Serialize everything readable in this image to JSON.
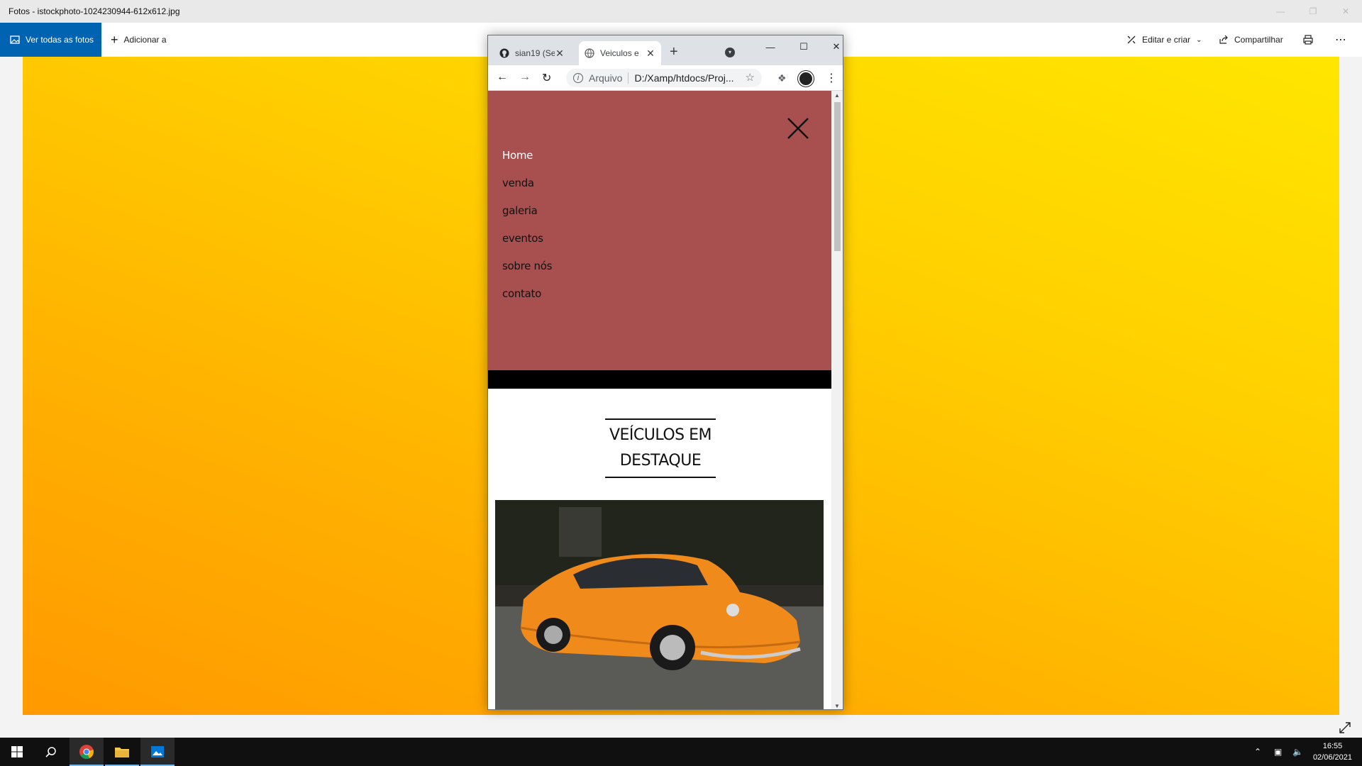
{
  "photos_app": {
    "title": "Fotos - istockphoto-1024230944-612x612.jpg",
    "toolbar": {
      "view_all": "Ver todas as fotos",
      "add_to": "Adicionar a",
      "edit_create": "Editar e criar",
      "share": "Compartilhar"
    }
  },
  "browser": {
    "tabs": [
      {
        "label": "sian19 (Se",
        "icon": "github-icon"
      },
      {
        "label": "Veiculos e",
        "icon": "globe-icon",
        "active": true
      }
    ],
    "address": {
      "scheme_label": "Arquivo",
      "url": "D:/Xamp/htdocs/Proj..."
    }
  },
  "page": {
    "menu_items": [
      "Home",
      "venda",
      "galeria",
      "eventos",
      "sobre nós",
      "contato"
    ],
    "menu_bg": "#a85050",
    "section_title": "VEÍCULOS EM DESTAQUE"
  },
  "taskbar": {
    "time": "16:55",
    "date": "02/06/2021"
  },
  "colors": {
    "accent": "#0063b1",
    "photo_top": "#ffe600",
    "photo_bottom": "#ff9900",
    "car": "#f08a1a"
  }
}
